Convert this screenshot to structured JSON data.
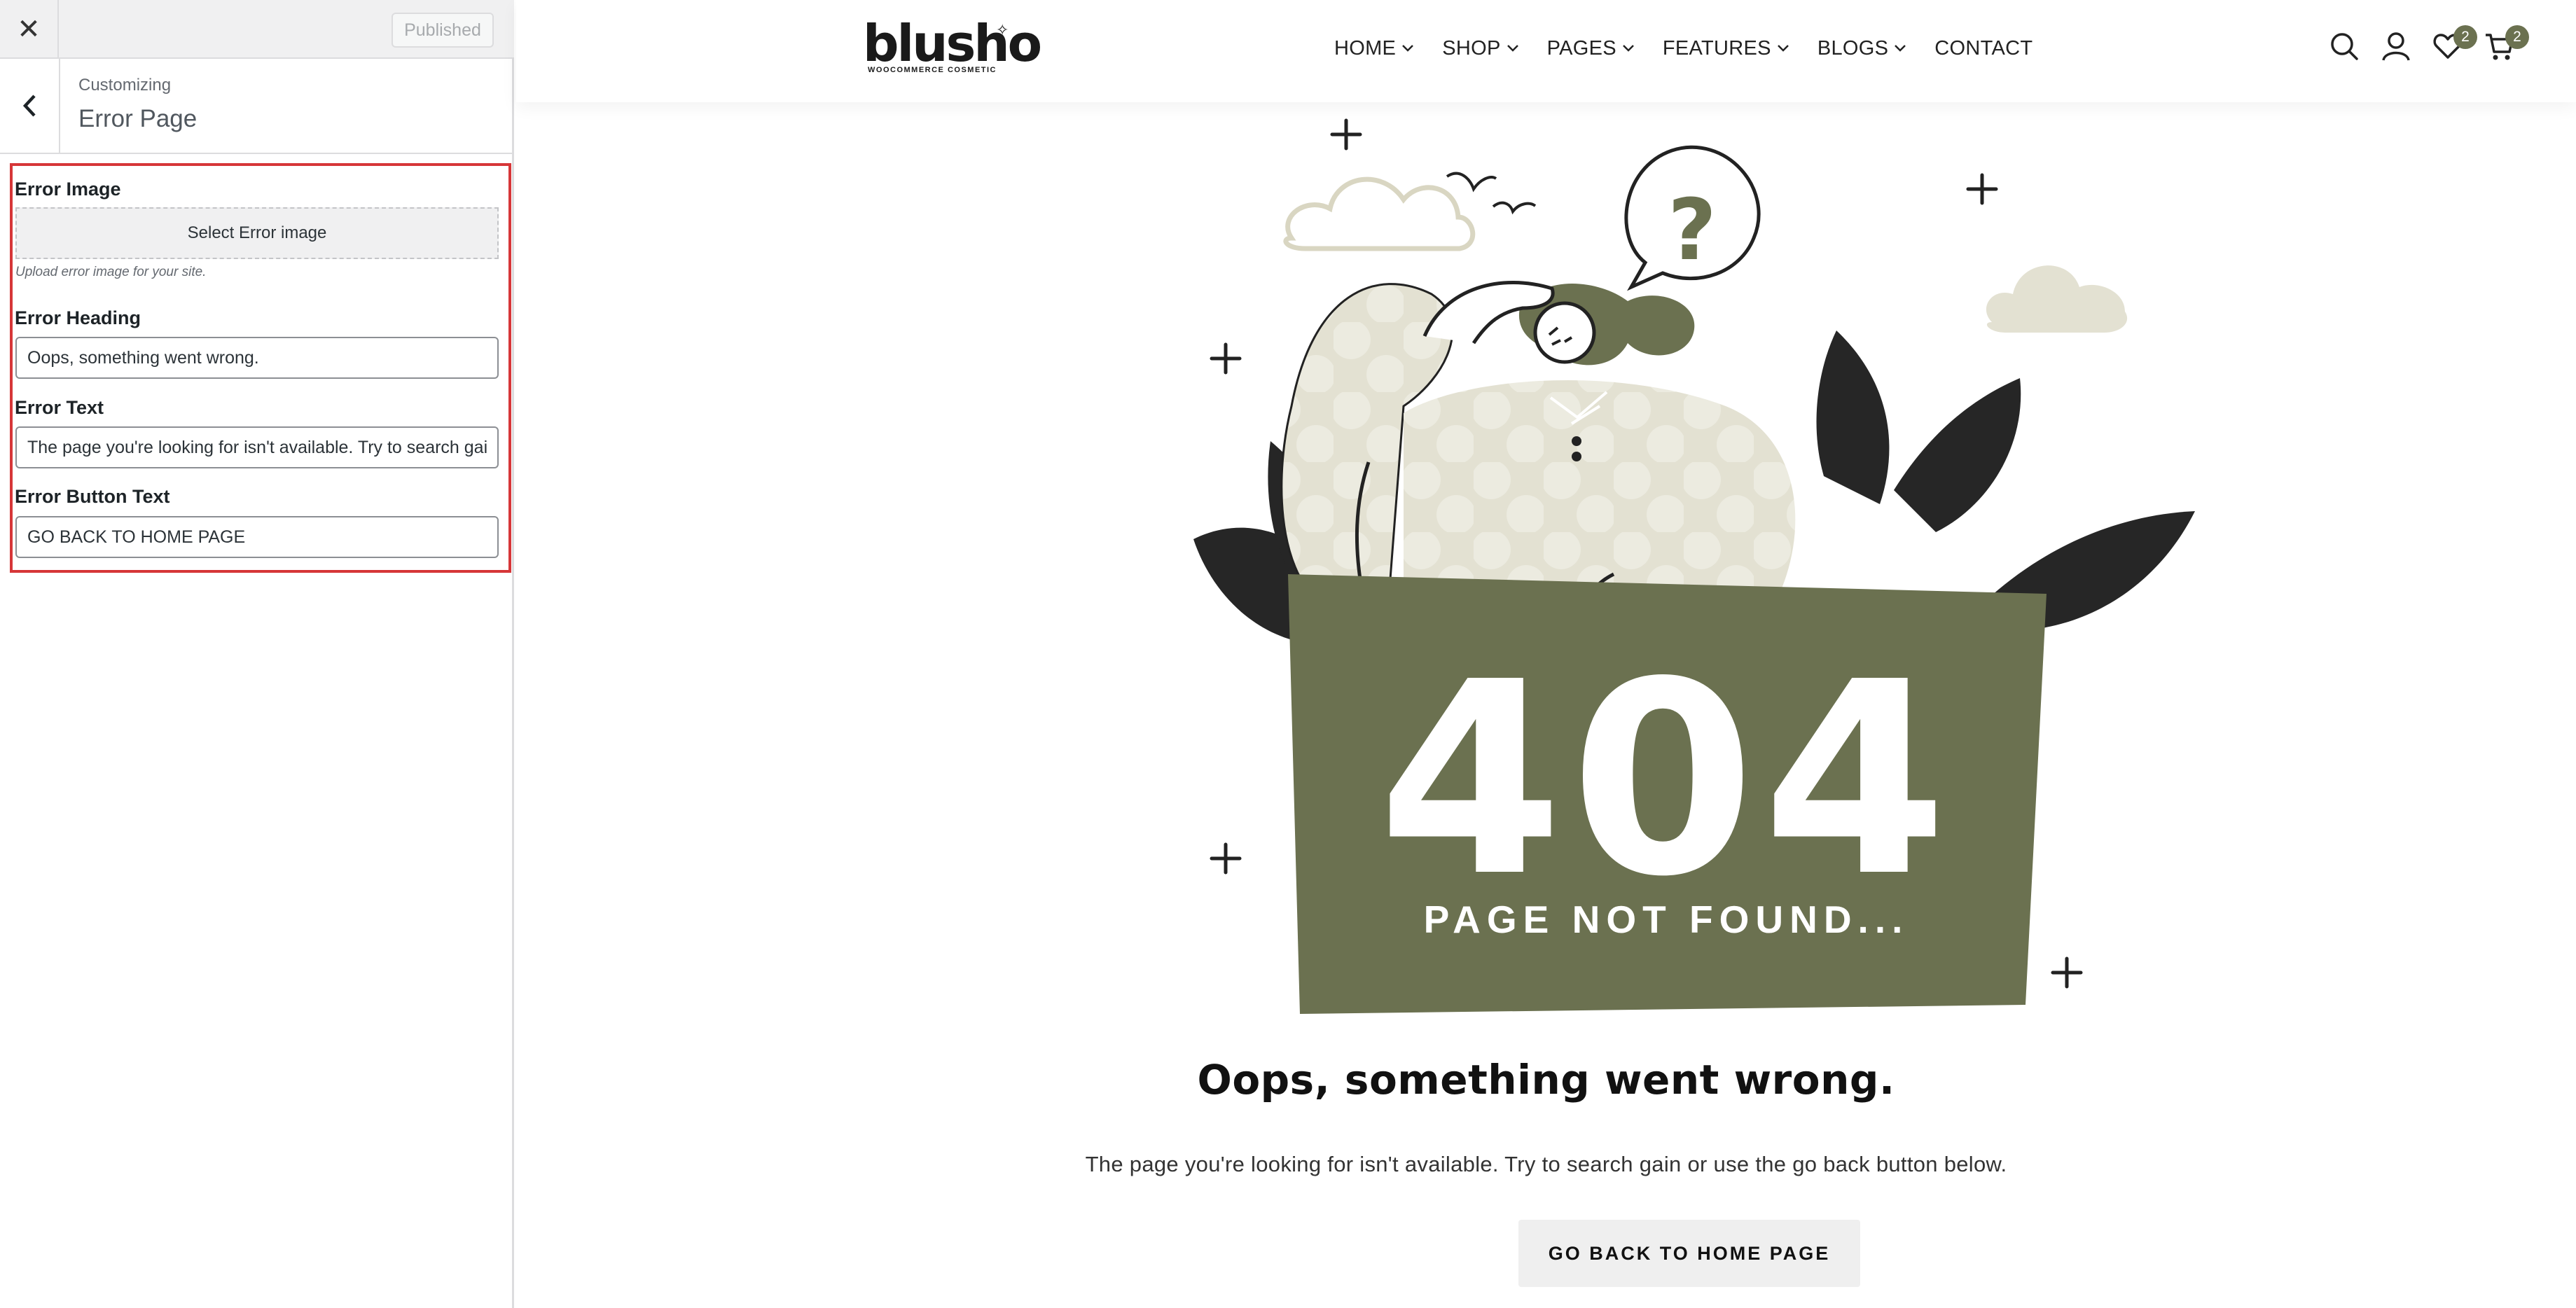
{
  "customizer": {
    "publish_label": "Published",
    "breadcrumb": "Customizing",
    "section_title": "Error Page",
    "controls": {
      "error_image_label": "Error Image",
      "select_image_button": "Select Error image",
      "image_description": "Upload error image for your site.",
      "error_heading_label": "Error Heading",
      "error_heading_value": "Oops, something went wrong.",
      "error_text_label": "Error Text",
      "error_text_value": "The page you're looking for isn't available. Try to search gain or use the go back button below.",
      "error_button_label": "Error Button Text",
      "error_button_value": "GO BACK TO HOME PAGE"
    }
  },
  "site": {
    "logo_text": "blusho",
    "logo_tagline": "WOOCOMMERCE COSMETIC",
    "nav": [
      {
        "label": "HOME",
        "has_dropdown": true
      },
      {
        "label": "SHOP",
        "has_dropdown": true
      },
      {
        "label": "PAGES",
        "has_dropdown": true
      },
      {
        "label": "FEATURES",
        "has_dropdown": true
      },
      {
        "label": "BLOGS",
        "has_dropdown": true
      },
      {
        "label": "CONTACT",
        "has_dropdown": false
      }
    ],
    "header_icons": {
      "search": "search-icon",
      "account": "user-icon",
      "wishlist": "heart-icon",
      "cart": "cart-icon"
    },
    "wishlist_count": "2",
    "cart_count": "2",
    "illustration": {
      "code": "404",
      "caption": "PAGE NOT FOUND..."
    },
    "error_heading": "Oops, something went wrong.",
    "error_text": "The page you're looking for isn't available. Try to search gain or use the go back button below.",
    "error_button": "GO BACK TO HOME PAGE"
  },
  "colors": {
    "accent_olive": "#6b7150",
    "panel_highlight": "#d63638",
    "pattern_beige": "#e3e1d2",
    "leaf_dark": "#262626"
  }
}
